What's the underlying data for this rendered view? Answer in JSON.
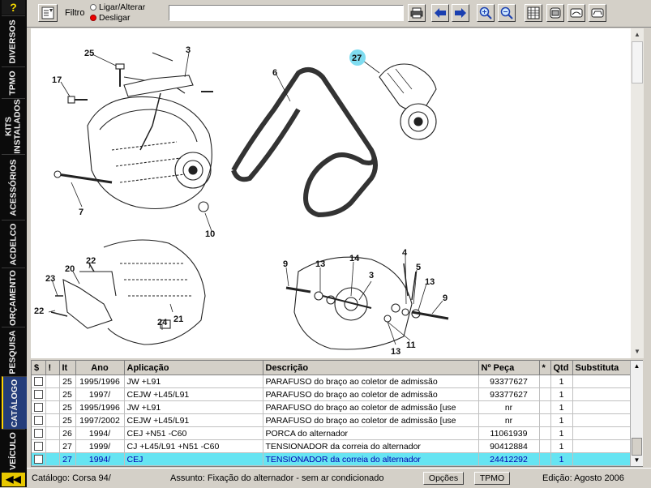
{
  "nav": {
    "help": "?",
    "tabs": [
      {
        "id": "diversos",
        "label": "DIVERSOS"
      },
      {
        "id": "tpmo",
        "label": "TPMO"
      },
      {
        "id": "kits",
        "label": "KITS INSTALADOS"
      },
      {
        "id": "acessorios",
        "label": "ACESSÓRIOS"
      },
      {
        "id": "acdelco",
        "label": "ACDELCO"
      },
      {
        "id": "orcamento",
        "label": "ORÇAMENTO"
      },
      {
        "id": "pesquisa",
        "label": "PESQUISA"
      },
      {
        "id": "catalogo",
        "label": "CATÁLOGO"
      },
      {
        "id": "veiculo",
        "label": "VEÍCULO"
      }
    ],
    "back": "◀◀"
  },
  "toolbar": {
    "filtro_label": "Filtro",
    "radio_on_label": "Ligar/Alterar",
    "radio_off_label": "Desligar",
    "filter_value": "",
    "icons": [
      "filter-icon",
      "print-icon",
      "arrow-left-icon",
      "arrow-right-icon",
      "zoom-in-icon",
      "zoom-out-icon",
      "grid-view-icon",
      "car-top-icon",
      "car-side-icon",
      "car-wagon-icon"
    ]
  },
  "diagram": {
    "callouts": [
      "25",
      "3",
      "17",
      "6",
      "27",
      "7",
      "10",
      "22",
      "20",
      "23",
      "22",
      "21",
      "24",
      "9",
      "13",
      "14",
      "3",
      "4",
      "5",
      "13",
      "9",
      "13",
      "11"
    ],
    "highlight": "27"
  },
  "grid": {
    "columns": [
      "$",
      "!",
      "It",
      "Ano",
      "Aplicação",
      "Descrição",
      "Nº Peça",
      "*",
      "Qtd",
      "Substituta"
    ],
    "rows": [
      {
        "it": "25",
        "ano": "1995/1996",
        "aplicacao": "JW +L91",
        "descricao": "PARAFUSO do braço ao coletor de admissão",
        "peca": "93377627",
        "qtd": "1",
        "sub": ""
      },
      {
        "it": "25",
        "ano": "1997/",
        "aplicacao": "CEJW +L45/L91",
        "descricao": "PARAFUSO do braço ao coletor de admissão",
        "peca": "93377627",
        "qtd": "1",
        "sub": ""
      },
      {
        "it": "25",
        "ano": "1995/1996",
        "aplicacao": "JW +L91",
        "descricao": "PARAFUSO do braço ao coletor de admissão [use",
        "peca": "nr",
        "qtd": "1",
        "sub": ""
      },
      {
        "it": "25",
        "ano": "1997/2002",
        "aplicacao": "CEJW +L45/L91",
        "descricao": "PARAFUSO do braço ao coletor de admissão [use",
        "peca": "nr",
        "qtd": "1",
        "sub": ""
      },
      {
        "it": "26",
        "ano": "1994/",
        "aplicacao": "CEJ +N51 -C60",
        "descricao": "PORCA do alternador",
        "peca": "11061939",
        "qtd": "1",
        "sub": ""
      },
      {
        "it": "27",
        "ano": "1999/",
        "aplicacao": "CJ +L45/L91 +N51 -C60",
        "descricao": "TENSIONADOR da correia do alternador",
        "peca": "90412884",
        "qtd": "1",
        "sub": ""
      },
      {
        "it": "27",
        "ano": "1994/",
        "aplicacao": "CEJ",
        "descricao": "TENSIONADOR da correia do alternador",
        "peca": "24412292",
        "qtd": "1",
        "sub": ""
      }
    ],
    "selected_index": 6
  },
  "status": {
    "catalogo": "Catálogo: Corsa 94/",
    "assunto": "Assunto: Fixação do alternador - sem ar condicionado",
    "opcoes": "Opções",
    "tpmo": "TPMO",
    "edicao": "Edição: Agosto 2006"
  },
  "colors": {
    "nav_bg": "#0b0b0b",
    "nav_active": "#243d7a",
    "selected_row": "#66e4f2",
    "callout_highlight": "#7fdcf0"
  }
}
